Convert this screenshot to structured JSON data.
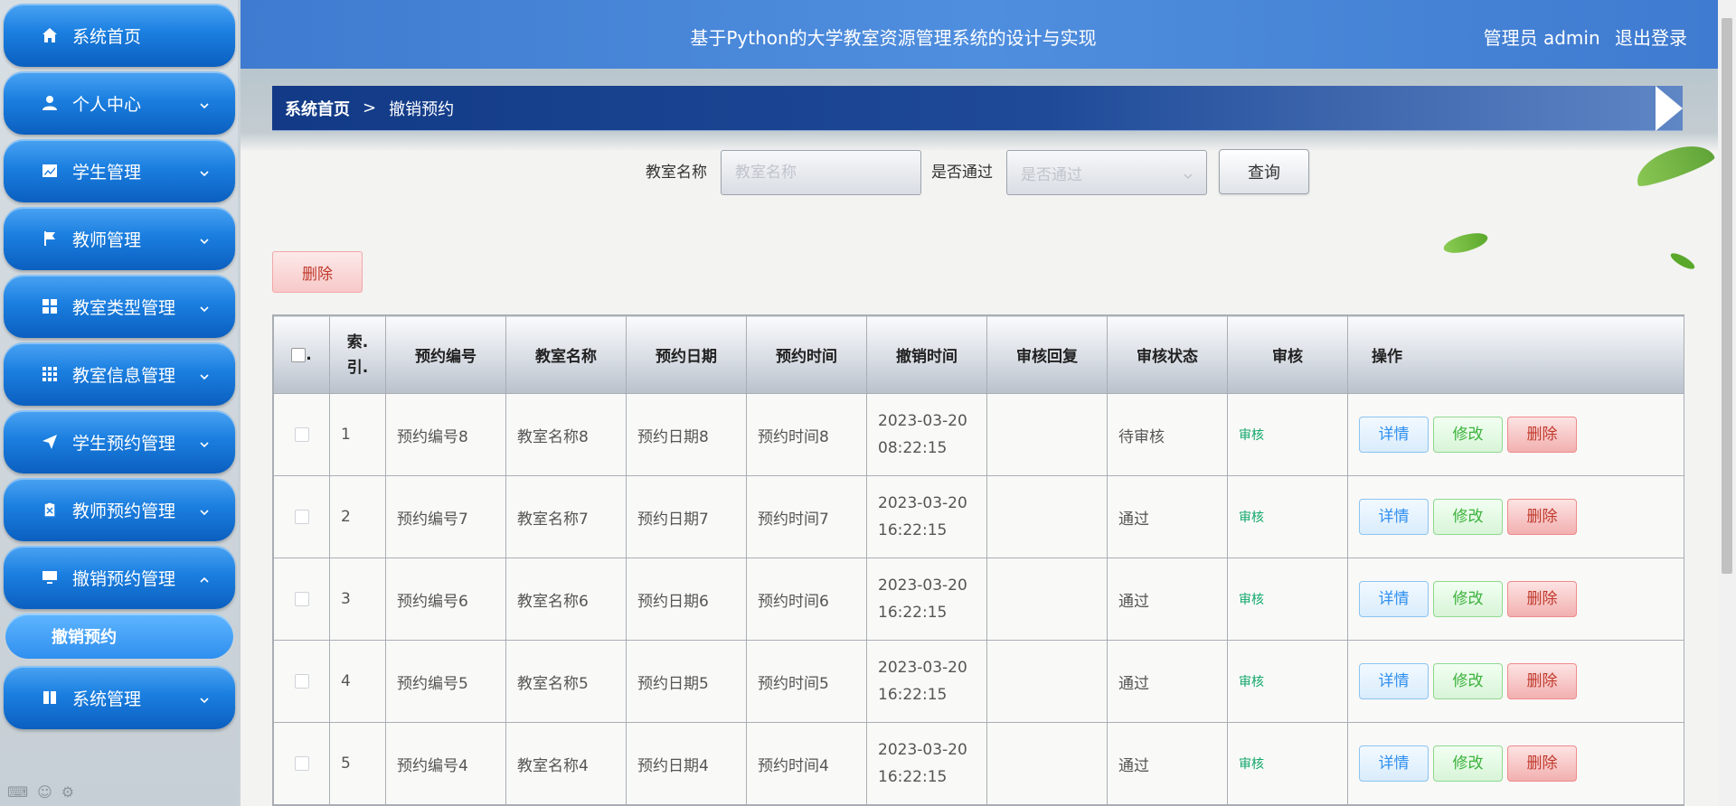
{
  "header": {
    "title": "基于Python的大学教室资源管理系统的设计与实现",
    "user_label": "管理员 admin",
    "logout_label": "退出登录"
  },
  "sidebar": {
    "items": [
      {
        "label": "系统首页",
        "icon": "home-icon",
        "has_chevron": false
      },
      {
        "label": "个人中心",
        "icon": "user-icon",
        "has_chevron": true
      },
      {
        "label": "学生管理",
        "icon": "chart-icon",
        "has_chevron": true
      },
      {
        "label": "教师管理",
        "icon": "flag-icon",
        "has_chevron": true
      },
      {
        "label": "教室类型管理",
        "icon": "grid-icon",
        "has_chevron": true
      },
      {
        "label": "教室信息管理",
        "icon": "apps-icon",
        "has_chevron": true
      },
      {
        "label": "学生预约管理",
        "icon": "paper-plane-icon",
        "has_chevron": true
      },
      {
        "label": "教师预约管理",
        "icon": "clipboard-icon",
        "has_chevron": true
      },
      {
        "label": "撤销预约管理",
        "icon": "monitor-icon",
        "has_chevron": true,
        "expanded": true
      },
      {
        "label": "系统管理",
        "icon": "book-icon",
        "has_chevron": true
      }
    ],
    "submenu": {
      "label": "撤销预约"
    }
  },
  "breadcrumb": {
    "home": "系统首页",
    "separator": ">",
    "current": "撤销预约"
  },
  "search": {
    "classroom_label": "教室名称",
    "classroom_placeholder": "教室名称",
    "approved_label": "是否通过",
    "approved_placeholder": "是否通过",
    "query_label": "查询"
  },
  "toolbar": {
    "delete_label": "删除"
  },
  "table": {
    "columns": [
      "",
      "索引",
      "预约编号",
      "教室名称",
      "预约日期",
      "预约时间",
      "撤销时间",
      "审核回复",
      "审核状态",
      "审核",
      "操作"
    ],
    "checkbox_header_suffix": ".",
    "index_header": "索.\n引.",
    "rows": [
      {
        "index": "1",
        "booking_no": "预约编号8",
        "classroom": "教室名称8",
        "date": "预约日期8",
        "time": "预约时间8",
        "cancel_date": "2023-03-20",
        "cancel_time": "08:22:15",
        "reply": "",
        "status": "待审核",
        "audit": "审核"
      },
      {
        "index": "2",
        "booking_no": "预约编号7",
        "classroom": "教室名称7",
        "date": "预约日期7",
        "time": "预约时间7",
        "cancel_date": "2023-03-20",
        "cancel_time": "16:22:15",
        "reply": "",
        "status": "通过",
        "audit": "审核"
      },
      {
        "index": "3",
        "booking_no": "预约编号6",
        "classroom": "教室名称6",
        "date": "预约日期6",
        "time": "预约时间6",
        "cancel_date": "2023-03-20",
        "cancel_time": "16:22:15",
        "reply": "",
        "status": "通过",
        "audit": "审核"
      },
      {
        "index": "4",
        "booking_no": "预约编号5",
        "classroom": "教室名称5",
        "date": "预约日期5",
        "time": "预约时间5",
        "cancel_date": "2023-03-20",
        "cancel_time": "16:22:15",
        "reply": "",
        "status": "通过",
        "audit": "审核"
      },
      {
        "index": "5",
        "booking_no": "预约编号4",
        "classroom": "教室名称4",
        "date": "预约日期4",
        "time": "预约时间4",
        "cancel_date": "2023-03-20",
        "cancel_time": "16:22:15",
        "reply": "",
        "status": "通过",
        "audit": "审核"
      }
    ],
    "actions": {
      "detail": "详情",
      "edit": "修改",
      "delete": "删除"
    }
  },
  "colors": {
    "sidebar_button": "#1b7fe0",
    "header_bg": "#4f8ede",
    "breadcrumb_bg": "#123a86",
    "audit_link": "#13a86b"
  }
}
